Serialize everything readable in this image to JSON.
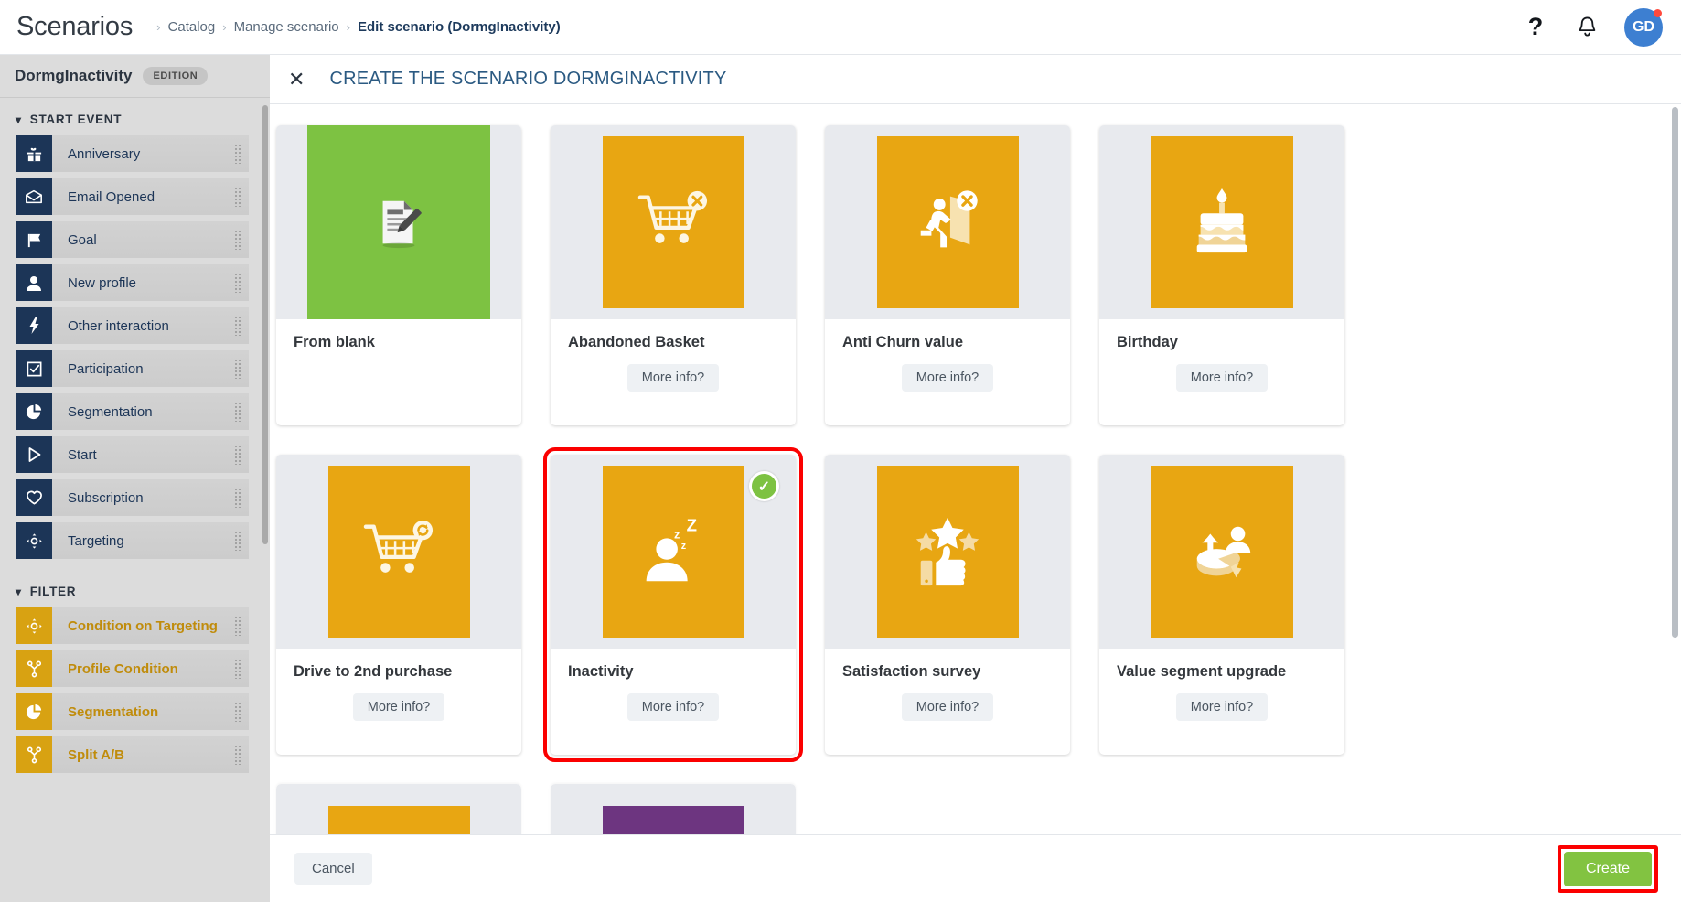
{
  "header": {
    "app_title": "Scenarios",
    "breadcrumb": [
      {
        "label": "Catalog",
        "active": false
      },
      {
        "label": "Manage scenario",
        "active": false
      },
      {
        "label": "Edit scenario (DormgInactivity)",
        "active": true
      }
    ],
    "separator": "›",
    "help_icon": "help-question-icon",
    "help_glyph": "?",
    "notifications_icon": "bell-icon",
    "avatar_initials": "GD",
    "avatar_color": "#3d7fd1",
    "notification_dot_color": "#ff4a3d"
  },
  "sidebar": {
    "scenario_name": "DormgInactivity",
    "edition_badge": "EDITION",
    "groups": [
      {
        "title": "START EVENT",
        "kind": "start",
        "items": [
          {
            "label": "Anniversary",
            "icon": "gift-icon"
          },
          {
            "label": "Email Opened",
            "icon": "open-envelope-icon"
          },
          {
            "label": "Goal",
            "icon": "flag-icon"
          },
          {
            "label": "New profile",
            "icon": "person-icon"
          },
          {
            "label": "Other interaction",
            "icon": "lightning-bolt-icon"
          },
          {
            "label": "Participation",
            "icon": "checkbox-icon"
          },
          {
            "label": "Segmentation",
            "icon": "pie-chart-icon"
          },
          {
            "label": "Start",
            "icon": "play-triangle-icon"
          },
          {
            "label": "Subscription",
            "icon": "heart-icon"
          },
          {
            "label": "Targeting",
            "icon": "target-crosshair-icon"
          }
        ]
      },
      {
        "title": "FILTER",
        "kind": "filter",
        "items": [
          {
            "label": "Condition on Targeting",
            "icon": "target-crosshair-icon"
          },
          {
            "label": "Profile Condition",
            "icon": "branch-icon"
          },
          {
            "label": "Segmentation",
            "icon": "pie-chart-icon"
          },
          {
            "label": "Split A/B",
            "icon": "branch-icon"
          }
        ]
      }
    ],
    "start_icon_color": "#1c3557",
    "filter_icon_color": "#d8a212"
  },
  "panel": {
    "close_icon": "close-x-icon",
    "title": "CREATE THE SCENARIO DORMGINACTIVITY",
    "more_info_label": "More info?",
    "selected_badge_icon": "check-circle-icon",
    "selection_outline_color": "#fb0000",
    "cards": [
      {
        "title": "From blank",
        "icon": "document-pencil-icon",
        "tile_color": "#7dc242",
        "has_more_info": false,
        "selected": false
      },
      {
        "title": "Abandoned Basket",
        "icon": "cart-cancel-icon",
        "tile_color": "#e8a612",
        "has_more_info": true,
        "selected": false
      },
      {
        "title": "Anti Churn value",
        "icon": "running-exit-cancel-icon",
        "tile_color": "#e8a612",
        "has_more_info": true,
        "selected": false
      },
      {
        "title": "Birthday",
        "icon": "birthday-cake-icon",
        "tile_color": "#e8a612",
        "has_more_info": true,
        "selected": false
      },
      {
        "title": "Drive to 2nd purchase",
        "icon": "cart-refresh-icon",
        "tile_color": "#e8a612",
        "has_more_info": true,
        "selected": false
      },
      {
        "title": "Inactivity",
        "icon": "sleeping-person-icon",
        "tile_color": "#e8a612",
        "has_more_info": true,
        "selected": true
      },
      {
        "title": "Satisfaction survey",
        "icon": "thumbs-up-stars-icon",
        "tile_color": "#e8a612",
        "has_more_info": true,
        "selected": false
      },
      {
        "title": "Value segment upgrade",
        "icon": "pie-upgrade-icon",
        "tile_color": "#e8a612",
        "has_more_info": true,
        "selected": false
      }
    ],
    "partial_row_tiles": [
      {
        "tile_color": "#e8a612",
        "visible": true
      },
      {
        "tile_color": "#6d3580",
        "visible": true
      },
      {
        "tile_color": "",
        "visible": false
      },
      {
        "tile_color": "",
        "visible": false
      }
    ]
  },
  "footer": {
    "cancel_label": "Cancel",
    "create_label": "Create",
    "create_color": "#82c341",
    "create_highlight_color": "#fb0000"
  }
}
